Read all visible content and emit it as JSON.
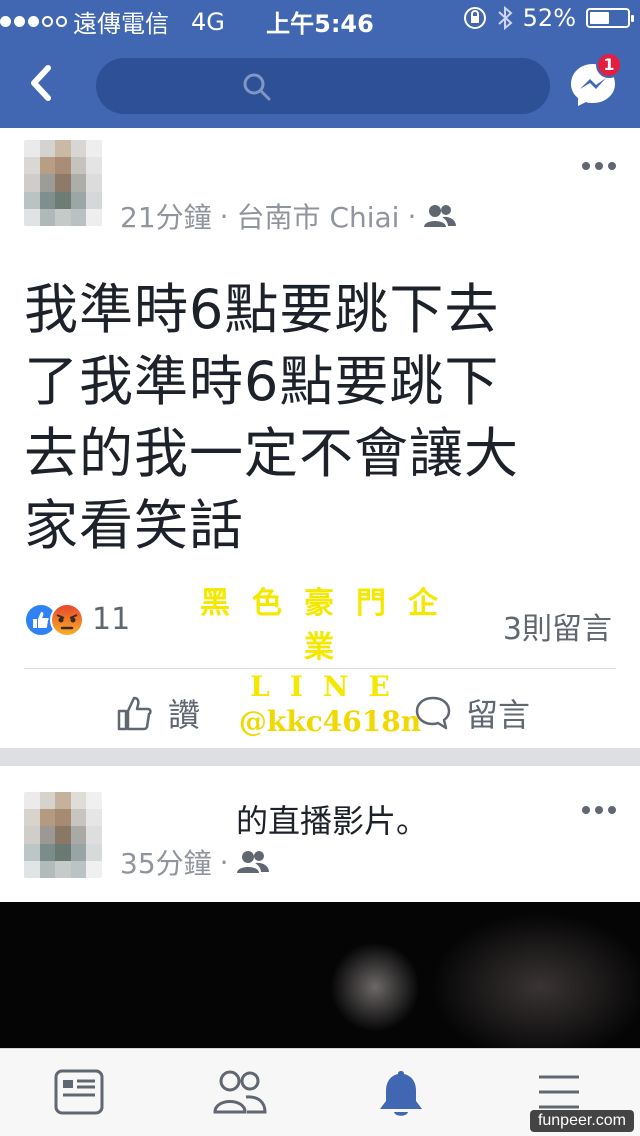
{
  "status_bar": {
    "carrier": "遠傳電信",
    "network": "4G",
    "time": "上午5:46",
    "battery": "52%",
    "battery_level": 0.52
  },
  "nav": {
    "search_placeholder": "",
    "messenger_badge": "1",
    "icons": [
      "back-icon",
      "search-icon",
      "messenger-icon"
    ]
  },
  "posts": [
    {
      "time": "21分鐘",
      "location": "台南市 Chiai",
      "text_lines": [
        "我準時6點要跳下去",
        "了我準時6點要跳下",
        "去的我一定不會讓大",
        "家看笑話"
      ],
      "reaction_count": "11",
      "comments": "3則留言",
      "like_label": "讚",
      "comment_label": "留言"
    },
    {
      "time": "35分鐘",
      "text": "的直播影片。"
    }
  ],
  "watermark": {
    "line1": "黑色豪門企業",
    "line2": "LINE",
    "line3": "@kkc4618n"
  },
  "tabbar": {
    "tabs": [
      "news-feed-icon",
      "friends-icon",
      "notifications-icon",
      "menu-icon"
    ],
    "active_color": "#4267b2"
  },
  "credit": "funpeer.com",
  "colors": {
    "brand": "#4267b2",
    "badge": "#e41e3f",
    "like": "#2e82f5"
  }
}
